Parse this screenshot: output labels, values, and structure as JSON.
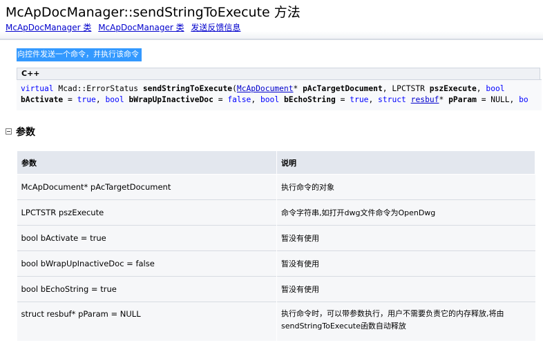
{
  "header": {
    "title": "McApDocManager::sendStringToExecute 方法",
    "links": [
      "McApDocManager 类",
      "McApDocManager 类",
      "发送反馈信息"
    ]
  },
  "summary": "向控件发送一个命令，并执行该命令",
  "code": {
    "language": "C++",
    "line1": {
      "kw_virtual": "virtual",
      "return_type": " Mcad::ErrorStatus ",
      "fn_name": "sendStringToExecute",
      "open_paren": "(",
      "type_link": "McApDocument",
      "p1_rest": "* ",
      "p1_name": "pAcTargetDocument",
      "p2_type": ", LPCTSTR ",
      "p2_name": "pszExecute",
      "sep": ", ",
      "kw_bool": "bool"
    },
    "line2": {
      "p3_name": "bActivate",
      "eq1": " = ",
      "val_true1": "true",
      "sep1": ", ",
      "kw_bool1": "bool",
      "sp1": " ",
      "p4_name": "bWrapUpInactiveDoc",
      "eq2": " = ",
      "val_false": "false",
      "sep2": ", ",
      "kw_bool2": "bool",
      "sp2": " ",
      "p5_name": "bEchoString",
      "eq3": " = ",
      "val_true2": "true",
      "sep3": ", ",
      "kw_struct": "struct",
      "sp3": " ",
      "type_link2": "resbuf",
      "p6_rest": "* ",
      "p6_name": "pParam",
      "p6_default": " = NULL, ",
      "trail": "bo"
    }
  },
  "params_section": {
    "title": "参数",
    "columns": [
      "参数",
      "说明"
    ],
    "rows": [
      {
        "param": "McApDocument* pAcTargetDocument",
        "desc": "执行命令的对象"
      },
      {
        "param": "LPCTSTR pszExecute",
        "desc": "命令字符串,如打开dwg文件命令为OpenDwg"
      },
      {
        "param": "bool bActivate = true",
        "desc": "暂没有使用"
      },
      {
        "param": "bool bWrapUpInactiveDoc = false",
        "desc": "暂没有使用"
      },
      {
        "param": "bool bEchoString = true",
        "desc": "暂没有使用"
      },
      {
        "param": "struct resbuf* pParam = NULL",
        "desc": "执行命令时，可以带参数执行，用户不需要负责它的内存释放,将由 sendStringToExecute函数自动释放"
      }
    ]
  }
}
